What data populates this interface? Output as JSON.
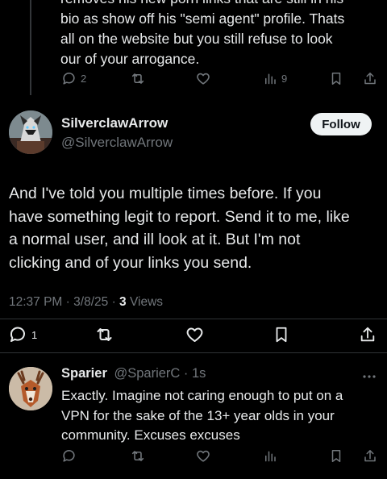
{
  "previous_tweet": {
    "lines": [
      "removes his new porn links that are still in his",
      "bio as show off his \"semi agent\" profile. Thats",
      "all on the website but you still refuse to look",
      "our of your arrogance."
    ],
    "reply_count": "2",
    "view_count": "9"
  },
  "main_tweet": {
    "display_name": "SilverclawArrow",
    "handle": "@SilverclawArrow",
    "follow_label": "Follow",
    "lines": [
      "And I've told you multiple times before. If you",
      "have something legit to report. Send it to me, like",
      "a normal user, and ill look at it. But I'm not",
      "clicking and of your links you send."
    ],
    "time": "12:37 PM",
    "date": "3/8/25",
    "views_count": "3",
    "views_label": "Views",
    "reply_count": "1"
  },
  "reply_tweet": {
    "display_name": "Sparier",
    "handle": "@SparierC",
    "age": "1s",
    "lines": [
      "Exactly. Imagine not caring enough to put on a",
      "VPN for the sake of the 13+ year olds in your",
      "community. Excuses excuses"
    ]
  },
  "colors": {
    "background": "#000000",
    "text": "#e7e9ea",
    "muted": "#71767b",
    "divider": "#2f3336",
    "follow_bg": "#eff3f4"
  },
  "icons": [
    "reply-icon",
    "retweet-icon",
    "like-icon",
    "views-icon",
    "bookmark-icon",
    "share-icon",
    "more-icon"
  ]
}
